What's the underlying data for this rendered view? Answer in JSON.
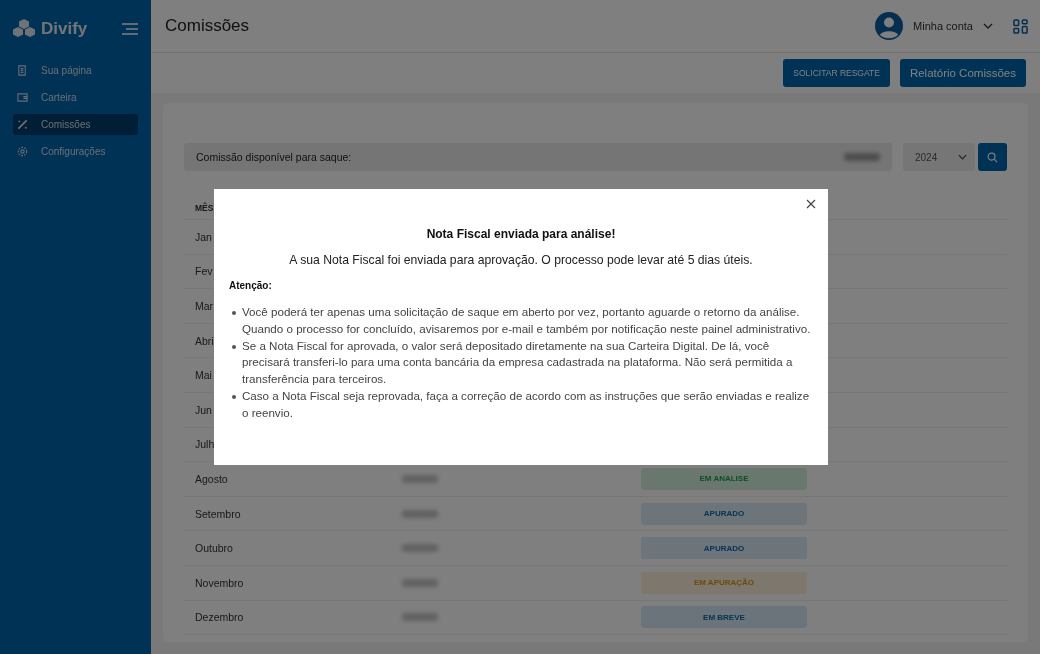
{
  "sidebar": {
    "brand": "Divify",
    "items": [
      {
        "label": "Sua página",
        "selected": false
      },
      {
        "label": "Carteira",
        "selected": false
      },
      {
        "label": "Comissões",
        "selected": true
      },
      {
        "label": "Configurações",
        "selected": false
      }
    ]
  },
  "header": {
    "title": "Comissões",
    "account": "Minha conta"
  },
  "toolbar": {
    "buttons": [
      "SOLICITAR RESGATE",
      "Relatório Comissões"
    ]
  },
  "filter": {
    "label": "Comissão disponível para saque:",
    "year": "2024"
  },
  "table": {
    "columns": [
      "MÊS"
    ],
    "rows": [
      {
        "month": "Jan"
      },
      {
        "month": "Fev"
      },
      {
        "month": "Mar"
      },
      {
        "month": "Abri"
      },
      {
        "month": "Mai"
      },
      {
        "month": "Jun"
      },
      {
        "month": "Julh"
      },
      {
        "month": "Agosto",
        "status": "EM ANALISE",
        "kind": "analysis"
      },
      {
        "month": "Setembro",
        "status": "APURADO",
        "kind": "done"
      },
      {
        "month": "Outubro",
        "status": "APURADO",
        "kind": "done"
      },
      {
        "month": "Novembro",
        "status": "EM APURAÇÃO",
        "kind": "pending"
      },
      {
        "month": "Dezembro",
        "status": "EM BREVE",
        "kind": "soon"
      }
    ]
  },
  "modal": {
    "title": "Nota Fiscal enviada para análise!",
    "message": "A sua Nota Fiscal foi enviada para aprovação. O processo pode levar até 5 dias úteis.",
    "attention": "Atenção:",
    "bullets": [
      "Você poderá ter apenas uma solicitação de saque em aberto por vez, portanto aguarde o retorno da análise. Quando o processo for concluído, avisaremos por e-mail e também por notificação neste painel administrativo.",
      "Se a Nota Fiscal for aprovada, o valor será depositado diretamente na sua Carteira Digital. De lá, você precisará transferi-lo para uma conta bancária da empresa cadastrada na plataforma. Não será permitida a transferência para terceiros.",
      "Caso a Nota Fiscal seja reprovada, faça a correção de acordo com as instruções que serão enviadas e realize o reenvio."
    ]
  }
}
